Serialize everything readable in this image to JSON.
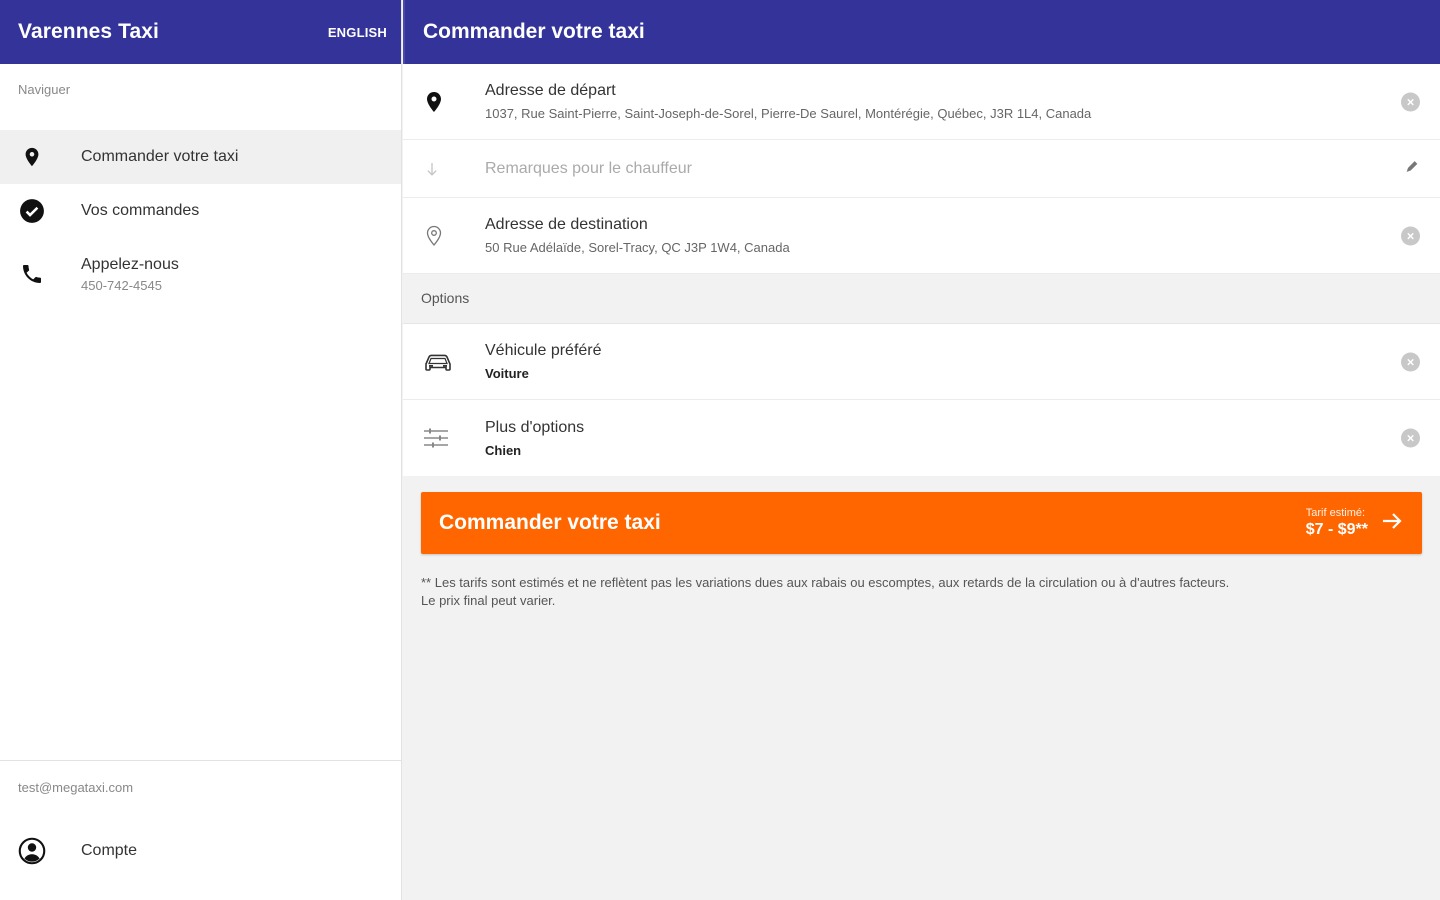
{
  "sidebar": {
    "app_title": "Varennes Taxi",
    "language_link": "ENGLISH",
    "nav_label": "Naviguer",
    "items": [
      {
        "label": "Commander votre taxi",
        "icon": "location-pin-icon"
      },
      {
        "label": "Vos commandes",
        "icon": "check-circle-icon"
      },
      {
        "label": "Appelez-nous",
        "sub": "450-742-4545",
        "icon": "phone-icon"
      }
    ],
    "email": "test@megataxi.com",
    "account_label": "Compte"
  },
  "main": {
    "title": "Commander votre taxi",
    "pickup": {
      "label": "Adresse de départ",
      "value": "1037, Rue Saint-Pierre, Saint-Joseph-de-Sorel, Pierre-De Saurel, Montérégie, Québec, J3R 1L4, Canada"
    },
    "notes": {
      "placeholder": "Remarques pour le chauffeur"
    },
    "destination": {
      "label": "Adresse de destination",
      "value": "50 Rue Adélaïde, Sorel-Tracy, QC J3P 1W4, Canada"
    },
    "options_label": "Options",
    "vehicle": {
      "label": "Véhicule préféré",
      "value": "Voiture"
    },
    "more_options": {
      "label": "Plus d'options",
      "value": "Chien"
    },
    "order_button": {
      "label": "Commander votre taxi",
      "fare_label": "Tarif estimé:",
      "fare_value": "$7 - $9**"
    },
    "disclaimer_line1": "** Les tarifs sont estimés et ne reflètent pas les variations dues aux rabais ou escomptes, aux retards de la circulation ou à d'autres facteurs.",
    "disclaimer_line2": "Le prix final peut varier."
  },
  "colors": {
    "header": "#333399",
    "accent": "#ff6600"
  }
}
